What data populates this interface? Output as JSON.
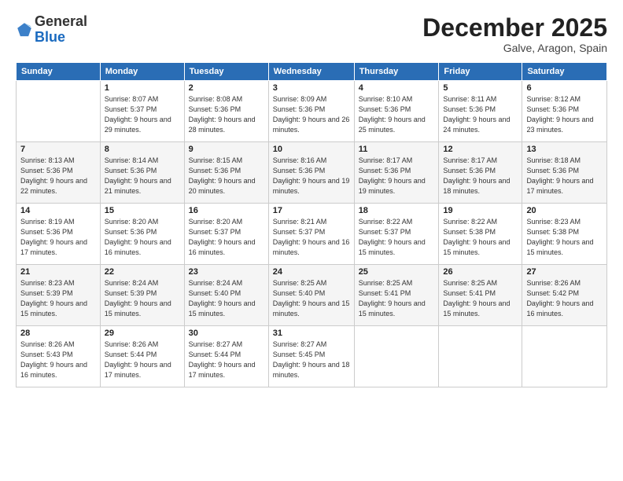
{
  "header": {
    "logo_line1": "General",
    "logo_line2": "Blue",
    "month": "December 2025",
    "location": "Galve, Aragon, Spain"
  },
  "days_of_week": [
    "Sunday",
    "Monday",
    "Tuesday",
    "Wednesday",
    "Thursday",
    "Friday",
    "Saturday"
  ],
  "weeks": [
    [
      {
        "num": "",
        "sunrise": "",
        "sunset": "",
        "daylight": ""
      },
      {
        "num": "1",
        "sunrise": "Sunrise: 8:07 AM",
        "sunset": "Sunset: 5:37 PM",
        "daylight": "Daylight: 9 hours and 29 minutes."
      },
      {
        "num": "2",
        "sunrise": "Sunrise: 8:08 AM",
        "sunset": "Sunset: 5:36 PM",
        "daylight": "Daylight: 9 hours and 28 minutes."
      },
      {
        "num": "3",
        "sunrise": "Sunrise: 8:09 AM",
        "sunset": "Sunset: 5:36 PM",
        "daylight": "Daylight: 9 hours and 26 minutes."
      },
      {
        "num": "4",
        "sunrise": "Sunrise: 8:10 AM",
        "sunset": "Sunset: 5:36 PM",
        "daylight": "Daylight: 9 hours and 25 minutes."
      },
      {
        "num": "5",
        "sunrise": "Sunrise: 8:11 AM",
        "sunset": "Sunset: 5:36 PM",
        "daylight": "Daylight: 9 hours and 24 minutes."
      },
      {
        "num": "6",
        "sunrise": "Sunrise: 8:12 AM",
        "sunset": "Sunset: 5:36 PM",
        "daylight": "Daylight: 9 hours and 23 minutes."
      }
    ],
    [
      {
        "num": "7",
        "sunrise": "Sunrise: 8:13 AM",
        "sunset": "Sunset: 5:36 PM",
        "daylight": "Daylight: 9 hours and 22 minutes."
      },
      {
        "num": "8",
        "sunrise": "Sunrise: 8:14 AM",
        "sunset": "Sunset: 5:36 PM",
        "daylight": "Daylight: 9 hours and 21 minutes."
      },
      {
        "num": "9",
        "sunrise": "Sunrise: 8:15 AM",
        "sunset": "Sunset: 5:36 PM",
        "daylight": "Daylight: 9 hours and 20 minutes."
      },
      {
        "num": "10",
        "sunrise": "Sunrise: 8:16 AM",
        "sunset": "Sunset: 5:36 PM",
        "daylight": "Daylight: 9 hours and 19 minutes."
      },
      {
        "num": "11",
        "sunrise": "Sunrise: 8:17 AM",
        "sunset": "Sunset: 5:36 PM",
        "daylight": "Daylight: 9 hours and 19 minutes."
      },
      {
        "num": "12",
        "sunrise": "Sunrise: 8:17 AM",
        "sunset": "Sunset: 5:36 PM",
        "daylight": "Daylight: 9 hours and 18 minutes."
      },
      {
        "num": "13",
        "sunrise": "Sunrise: 8:18 AM",
        "sunset": "Sunset: 5:36 PM",
        "daylight": "Daylight: 9 hours and 17 minutes."
      }
    ],
    [
      {
        "num": "14",
        "sunrise": "Sunrise: 8:19 AM",
        "sunset": "Sunset: 5:36 PM",
        "daylight": "Daylight: 9 hours and 17 minutes."
      },
      {
        "num": "15",
        "sunrise": "Sunrise: 8:20 AM",
        "sunset": "Sunset: 5:36 PM",
        "daylight": "Daylight: 9 hours and 16 minutes."
      },
      {
        "num": "16",
        "sunrise": "Sunrise: 8:20 AM",
        "sunset": "Sunset: 5:37 PM",
        "daylight": "Daylight: 9 hours and 16 minutes."
      },
      {
        "num": "17",
        "sunrise": "Sunrise: 8:21 AM",
        "sunset": "Sunset: 5:37 PM",
        "daylight": "Daylight: 9 hours and 16 minutes."
      },
      {
        "num": "18",
        "sunrise": "Sunrise: 8:22 AM",
        "sunset": "Sunset: 5:37 PM",
        "daylight": "Daylight: 9 hours and 15 minutes."
      },
      {
        "num": "19",
        "sunrise": "Sunrise: 8:22 AM",
        "sunset": "Sunset: 5:38 PM",
        "daylight": "Daylight: 9 hours and 15 minutes."
      },
      {
        "num": "20",
        "sunrise": "Sunrise: 8:23 AM",
        "sunset": "Sunset: 5:38 PM",
        "daylight": "Daylight: 9 hours and 15 minutes."
      }
    ],
    [
      {
        "num": "21",
        "sunrise": "Sunrise: 8:23 AM",
        "sunset": "Sunset: 5:39 PM",
        "daylight": "Daylight: 9 hours and 15 minutes."
      },
      {
        "num": "22",
        "sunrise": "Sunrise: 8:24 AM",
        "sunset": "Sunset: 5:39 PM",
        "daylight": "Daylight: 9 hours and 15 minutes."
      },
      {
        "num": "23",
        "sunrise": "Sunrise: 8:24 AM",
        "sunset": "Sunset: 5:40 PM",
        "daylight": "Daylight: 9 hours and 15 minutes."
      },
      {
        "num": "24",
        "sunrise": "Sunrise: 8:25 AM",
        "sunset": "Sunset: 5:40 PM",
        "daylight": "Daylight: 9 hours and 15 minutes."
      },
      {
        "num": "25",
        "sunrise": "Sunrise: 8:25 AM",
        "sunset": "Sunset: 5:41 PM",
        "daylight": "Daylight: 9 hours and 15 minutes."
      },
      {
        "num": "26",
        "sunrise": "Sunrise: 8:25 AM",
        "sunset": "Sunset: 5:41 PM",
        "daylight": "Daylight: 9 hours and 15 minutes."
      },
      {
        "num": "27",
        "sunrise": "Sunrise: 8:26 AM",
        "sunset": "Sunset: 5:42 PM",
        "daylight": "Daylight: 9 hours and 16 minutes."
      }
    ],
    [
      {
        "num": "28",
        "sunrise": "Sunrise: 8:26 AM",
        "sunset": "Sunset: 5:43 PM",
        "daylight": "Daylight: 9 hours and 16 minutes."
      },
      {
        "num": "29",
        "sunrise": "Sunrise: 8:26 AM",
        "sunset": "Sunset: 5:44 PM",
        "daylight": "Daylight: 9 hours and 17 minutes."
      },
      {
        "num": "30",
        "sunrise": "Sunrise: 8:27 AM",
        "sunset": "Sunset: 5:44 PM",
        "daylight": "Daylight: 9 hours and 17 minutes."
      },
      {
        "num": "31",
        "sunrise": "Sunrise: 8:27 AM",
        "sunset": "Sunset: 5:45 PM",
        "daylight": "Daylight: 9 hours and 18 minutes."
      },
      {
        "num": "",
        "sunrise": "",
        "sunset": "",
        "daylight": ""
      },
      {
        "num": "",
        "sunrise": "",
        "sunset": "",
        "daylight": ""
      },
      {
        "num": "",
        "sunrise": "",
        "sunset": "",
        "daylight": ""
      }
    ]
  ]
}
